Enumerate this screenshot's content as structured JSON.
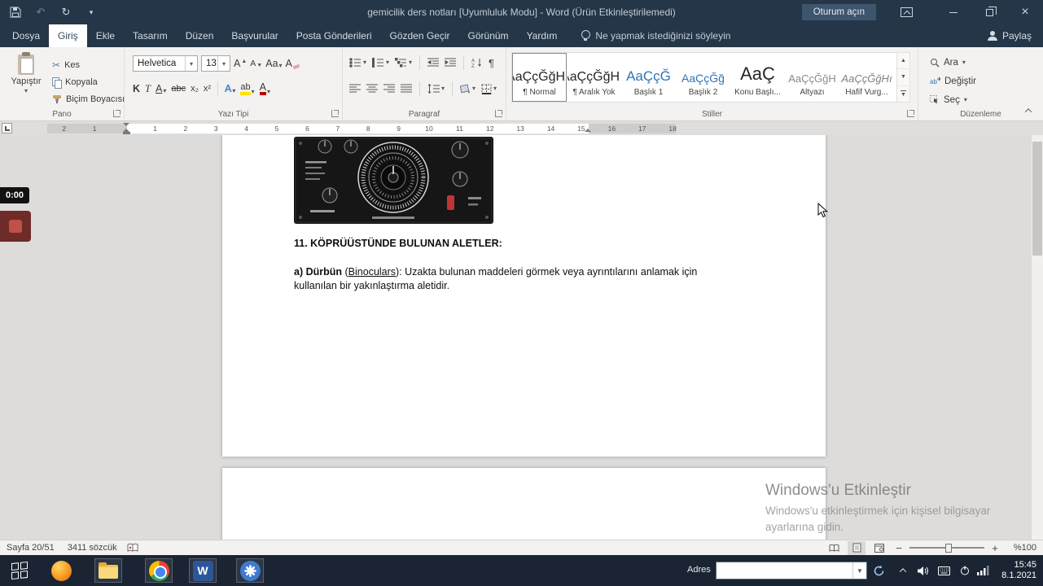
{
  "titlebar": {
    "title": "gemicilik ders notları [Uyumluluk Modu]  -  Word (Ürün Etkinleştirilemedi)",
    "signin_label": "Oturum açın"
  },
  "tabs": [
    {
      "label": "Dosya"
    },
    {
      "label": "Giriş"
    },
    {
      "label": "Ekle"
    },
    {
      "label": "Tasarım"
    },
    {
      "label": "Düzen"
    },
    {
      "label": "Başvurular"
    },
    {
      "label": "Posta Gönderileri"
    },
    {
      "label": "Gözden Geçir"
    },
    {
      "label": "Görünüm"
    },
    {
      "label": "Yardım"
    }
  ],
  "tell_me": "Ne yapmak istediğinizi söyleyin",
  "share_label": "Paylaş",
  "ribbon": {
    "clipboard": {
      "group_label": "Pano",
      "paste_label": "Yapıştır",
      "cut_label": "Kes",
      "copy_label": "Kopyala",
      "format_painter_label": "Biçim Boyacısı"
    },
    "font": {
      "group_label": "Yazı Tipi",
      "font_name": "Helvetica",
      "font_size": "13",
      "grow_label": "A",
      "shrink_label": "A",
      "change_case_label": "Aa",
      "bold_label": "K",
      "italic_label": "T",
      "underline_label": "A",
      "strikethrough_label": "abc",
      "subscript_label": "x₂",
      "superscript_label": "x²",
      "effects_label": "A",
      "highlight_label": "ab",
      "font_color_label": "A"
    },
    "paragraph": {
      "group_label": "Paragraf"
    },
    "styles": {
      "group_label": "Stiller",
      "items": [
        {
          "sample": "AaÇçĞğHh",
          "label": "¶ Normal"
        },
        {
          "sample": "AaÇçĞğHh",
          "label": "¶ Aralık Yok"
        },
        {
          "sample": "AaÇçĞ",
          "label": "Başlık 1"
        },
        {
          "sample": "AaÇçĞğ",
          "label": "Başlık 2"
        },
        {
          "sample": "AaÇ",
          "label": "Konu Başlı..."
        },
        {
          "sample": "AaÇçĞğH",
          "label": "Altyazı"
        },
        {
          "sample": "AaÇçĞğHı",
          "label": "Hafif Vurg..."
        }
      ]
    },
    "editing": {
      "group_label": "Düzenleme",
      "find_label": "Ara",
      "replace_label": "Değiştir",
      "select_label": "Seç"
    }
  },
  "ruler": {
    "numbers": [
      "2",
      "1",
      "1",
      "2",
      "3",
      "4",
      "5",
      "6",
      "7",
      "8",
      "9",
      "10",
      "11",
      "12",
      "13",
      "14",
      "15",
      "16",
      "17",
      "18"
    ]
  },
  "document": {
    "heading": "11. KÖPRÜÜSTÜNDE BULUNAN ALETLER:",
    "paragraph": {
      "bold": "a) Dürbün",
      "pre_underline": " (",
      "underlined": "Binoculars",
      "rest": "): Uzakta bulunan maddeleri görmek veya ayrıntılarını anlamak için kullanılan bir yakınlaştırma aletidir."
    }
  },
  "watermark": {
    "title": "Windows'u Etkinleştir",
    "line1": "Windows'u etkinleştirmek için kişisel bilgisayar",
    "line2": "ayarlarına gidin."
  },
  "statusbar": {
    "page_label": "Sayfa 20/51",
    "word_count": "3411 sözcük",
    "zoom_label": "%100"
  },
  "taskbar": {
    "address_label": "Adres",
    "clock_time": "15:45",
    "clock_date": "8.1.2021"
  },
  "recorder": {
    "time": "0:00"
  }
}
